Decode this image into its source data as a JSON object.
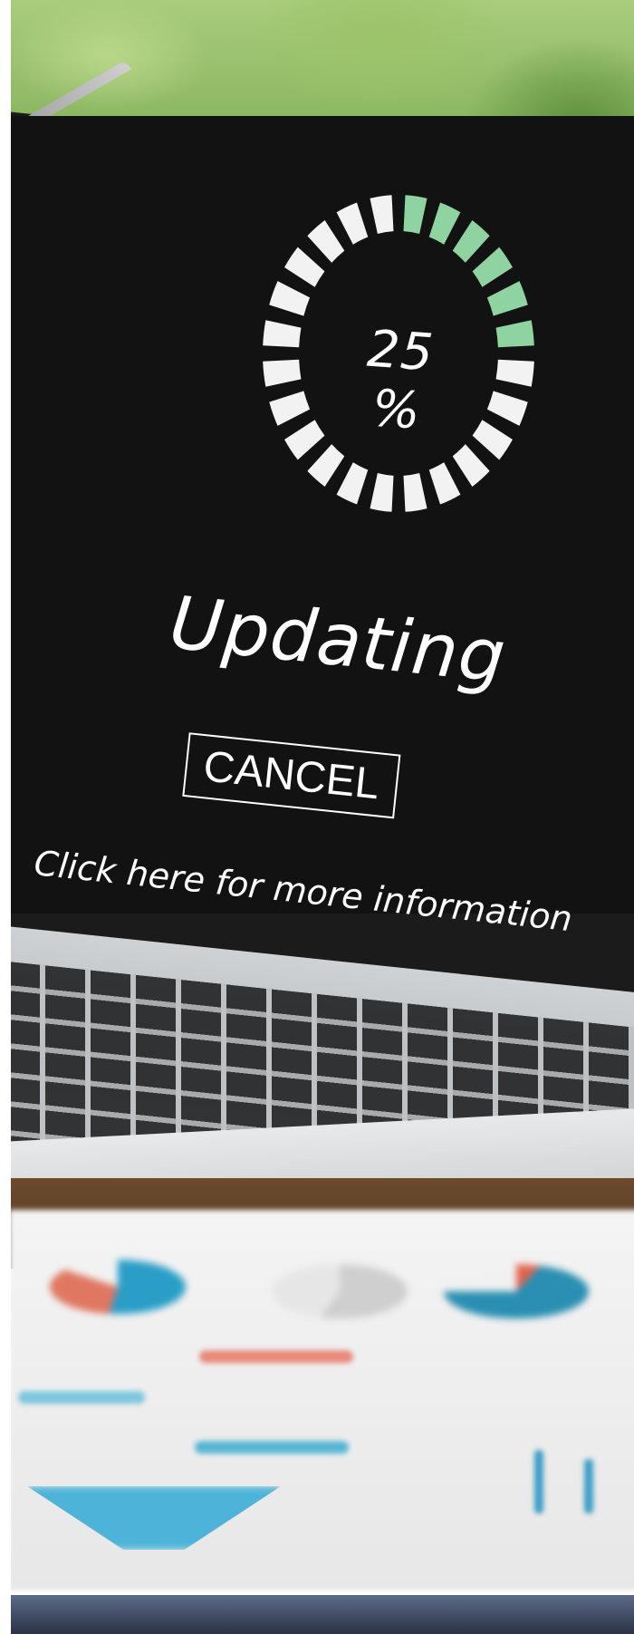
{
  "update_screen": {
    "progress_text": "25 %",
    "progress_fraction": 0.25,
    "status_title": "Updating",
    "cancel_label": "CANCEL",
    "info_link": "Click here for more information"
  },
  "colors": {
    "screen_background": "#121212",
    "ring_done": "#8fd3a0",
    "ring_todo": "#f2f2f2",
    "text": "#ffffff"
  }
}
